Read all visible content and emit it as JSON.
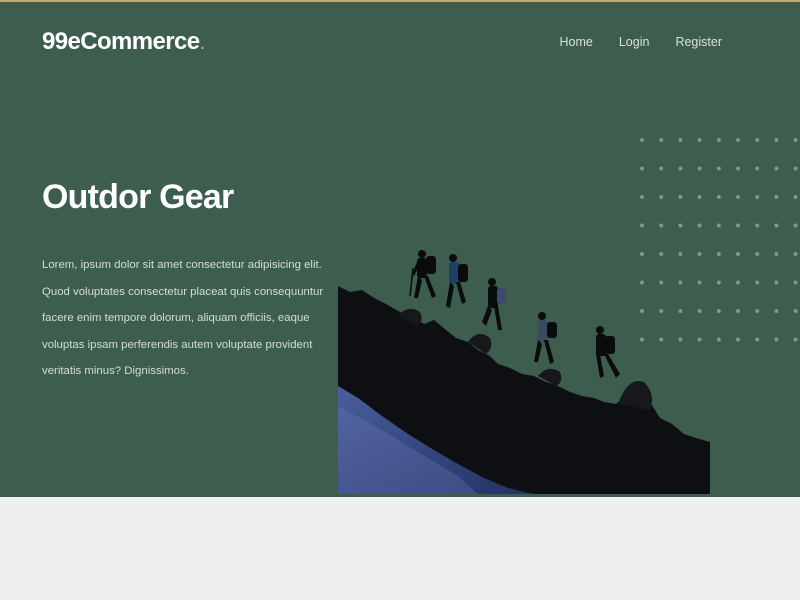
{
  "nav": {
    "brand": "99eCommerce",
    "brand_suffix": ".",
    "links": [
      {
        "label": "Home"
      },
      {
        "label": "Login"
      },
      {
        "label": "Register"
      }
    ]
  },
  "hero": {
    "title": "Outdor Gear",
    "description": "Lorem, ipsum dolor sit amet consectetur adipisicing elit. Quod voluptates consectetur placeat quis consequuntur facere enim tempore dolorum, aliquam officiis, eaque voluptas ipsam perferendis autem voluptate provident veritatis minus? Dignissimos.",
    "image": "hikers-silhouette-on-rocky-ridge"
  },
  "colors": {
    "hero_bg": "#3d5d4f",
    "page_bg": "#eef0ef",
    "top_accent": "#c9a96a",
    "text_light": "#d4ddd8"
  }
}
